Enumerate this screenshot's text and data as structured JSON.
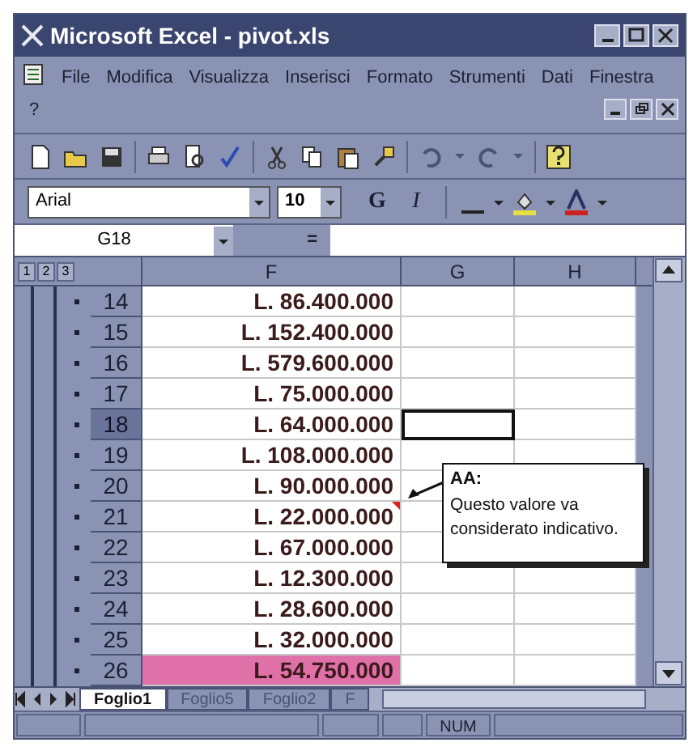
{
  "window": {
    "title": "Microsoft Excel - pivot.xls"
  },
  "menu": [
    "File",
    "Modifica",
    "Visualizza",
    "Inserisci",
    "Formato",
    "Strumenti",
    "Dati",
    "Finestra",
    "?"
  ],
  "format_bar": {
    "font": "Arial",
    "size": "10",
    "bold": "G",
    "italic": "I"
  },
  "formula_bar": {
    "cell": "G18",
    "equals": "="
  },
  "outline_levels": [
    "1",
    "2",
    "3"
  ],
  "columns": [
    {
      "label": "F"
    },
    {
      "label": "G"
    },
    {
      "label": "H"
    }
  ],
  "rows": [
    {
      "number": "14",
      "value": "L. 86.400.000",
      "selected": false,
      "highlighted": false,
      "comment": false
    },
    {
      "number": "15",
      "value": "L. 152.400.000",
      "selected": false,
      "highlighted": false,
      "comment": false
    },
    {
      "number": "16",
      "value": "L. 579.600.000",
      "selected": false,
      "highlighted": false,
      "comment": false
    },
    {
      "number": "17",
      "value": "L. 75.000.000",
      "selected": false,
      "highlighted": false,
      "comment": false
    },
    {
      "number": "18",
      "value": "L. 64.000.000",
      "selected": true,
      "highlighted": false,
      "comment": false
    },
    {
      "number": "19",
      "value": "L. 108.000.000",
      "selected": false,
      "highlighted": false,
      "comment": false
    },
    {
      "number": "20",
      "value": "L. 90.000.000",
      "selected": false,
      "highlighted": false,
      "comment": false
    },
    {
      "number": "21",
      "value": "L. 22.000.000",
      "selected": false,
      "highlighted": false,
      "comment": true
    },
    {
      "number": "22",
      "value": "L. 67.000.000",
      "selected": false,
      "highlighted": false,
      "comment": false
    },
    {
      "number": "23",
      "value": "L. 12.300.000",
      "selected": false,
      "highlighted": false,
      "comment": false
    },
    {
      "number": "24",
      "value": "L. 28.600.000",
      "selected": false,
      "highlighted": false,
      "comment": false
    },
    {
      "number": "25",
      "value": "L. 32.000.000",
      "selected": false,
      "highlighted": false,
      "comment": false
    },
    {
      "number": "26",
      "value": "L. 54.750.000",
      "selected": false,
      "highlighted": true,
      "comment": false
    }
  ],
  "comment": {
    "author": "AA:",
    "text": "Questo valore va considerato indicativo."
  },
  "sheet_tabs": [
    {
      "label": "Foglio1",
      "selected": true
    },
    {
      "label": "Foglio5",
      "selected": false
    },
    {
      "label": "Foglio2",
      "selected": false
    },
    {
      "label": "F",
      "selected": false
    }
  ],
  "status_bar": {
    "num": "NUM"
  }
}
